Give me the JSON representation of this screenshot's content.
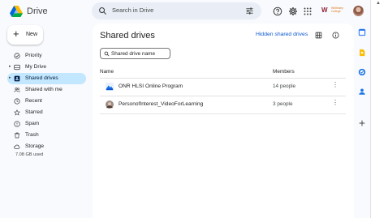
{
  "header": {
    "app_name": "Drive",
    "search_placeholder": "Search in Drive",
    "brand_text": "Wellesley College"
  },
  "sidebar": {
    "new_label": "New",
    "items": [
      {
        "label": "Priority",
        "icon": "priority-icon"
      },
      {
        "label": "My Drive",
        "icon": "my-drive-icon"
      },
      {
        "label": "Shared drives",
        "icon": "shared-drives-icon",
        "active": true
      },
      {
        "label": "Shared with me",
        "icon": "people-icon"
      },
      {
        "label": "Recent",
        "icon": "clock-icon"
      },
      {
        "label": "Starred",
        "icon": "star-icon"
      },
      {
        "label": "Spam",
        "icon": "spam-icon"
      },
      {
        "label": "Trash",
        "icon": "trash-icon"
      },
      {
        "label": "Storage",
        "icon": "cloud-icon"
      }
    ],
    "storage_used": "7.08 GB used"
  },
  "main": {
    "title": "Shared drives",
    "hidden_link": "Hidden shared drives",
    "filter_placeholder": "Shared drive name",
    "columns": {
      "name": "Name",
      "members": "Members"
    },
    "rows": [
      {
        "name": "ONR HLSI Online Program",
        "members": "14 people"
      },
      {
        "name": "PersonofInterest_VideoForLearning",
        "members": "3 people"
      }
    ]
  },
  "colors": {
    "accent": "#0b57d0",
    "active_nav_bg": "#c2e7ff",
    "background": "#f8fafd"
  }
}
